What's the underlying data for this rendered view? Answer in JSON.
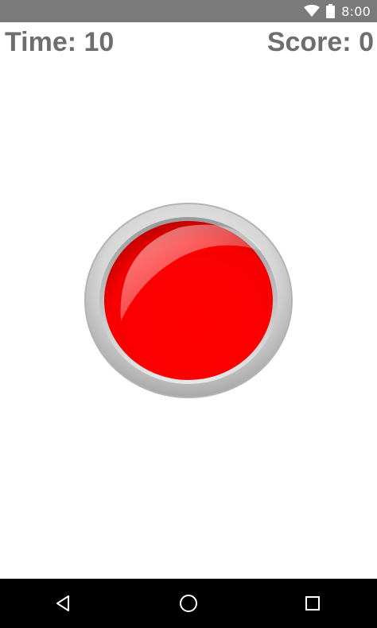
{
  "status_bar": {
    "time": "8:00",
    "icons": [
      "wifi-icon",
      "battery-icon"
    ],
    "background": "#7a7a7a"
  },
  "hud": {
    "time_label": "Time: 10",
    "score_label": "Score: 0",
    "text_color": "#6e6e6e"
  },
  "game": {
    "button_icon": "red-push-button",
    "button_color": "#ff0000",
    "rim_color": "#c8c8c8"
  },
  "nav_bar": {
    "icons": [
      "back-icon",
      "home-icon",
      "recents-icon"
    ],
    "background": "#000000"
  }
}
